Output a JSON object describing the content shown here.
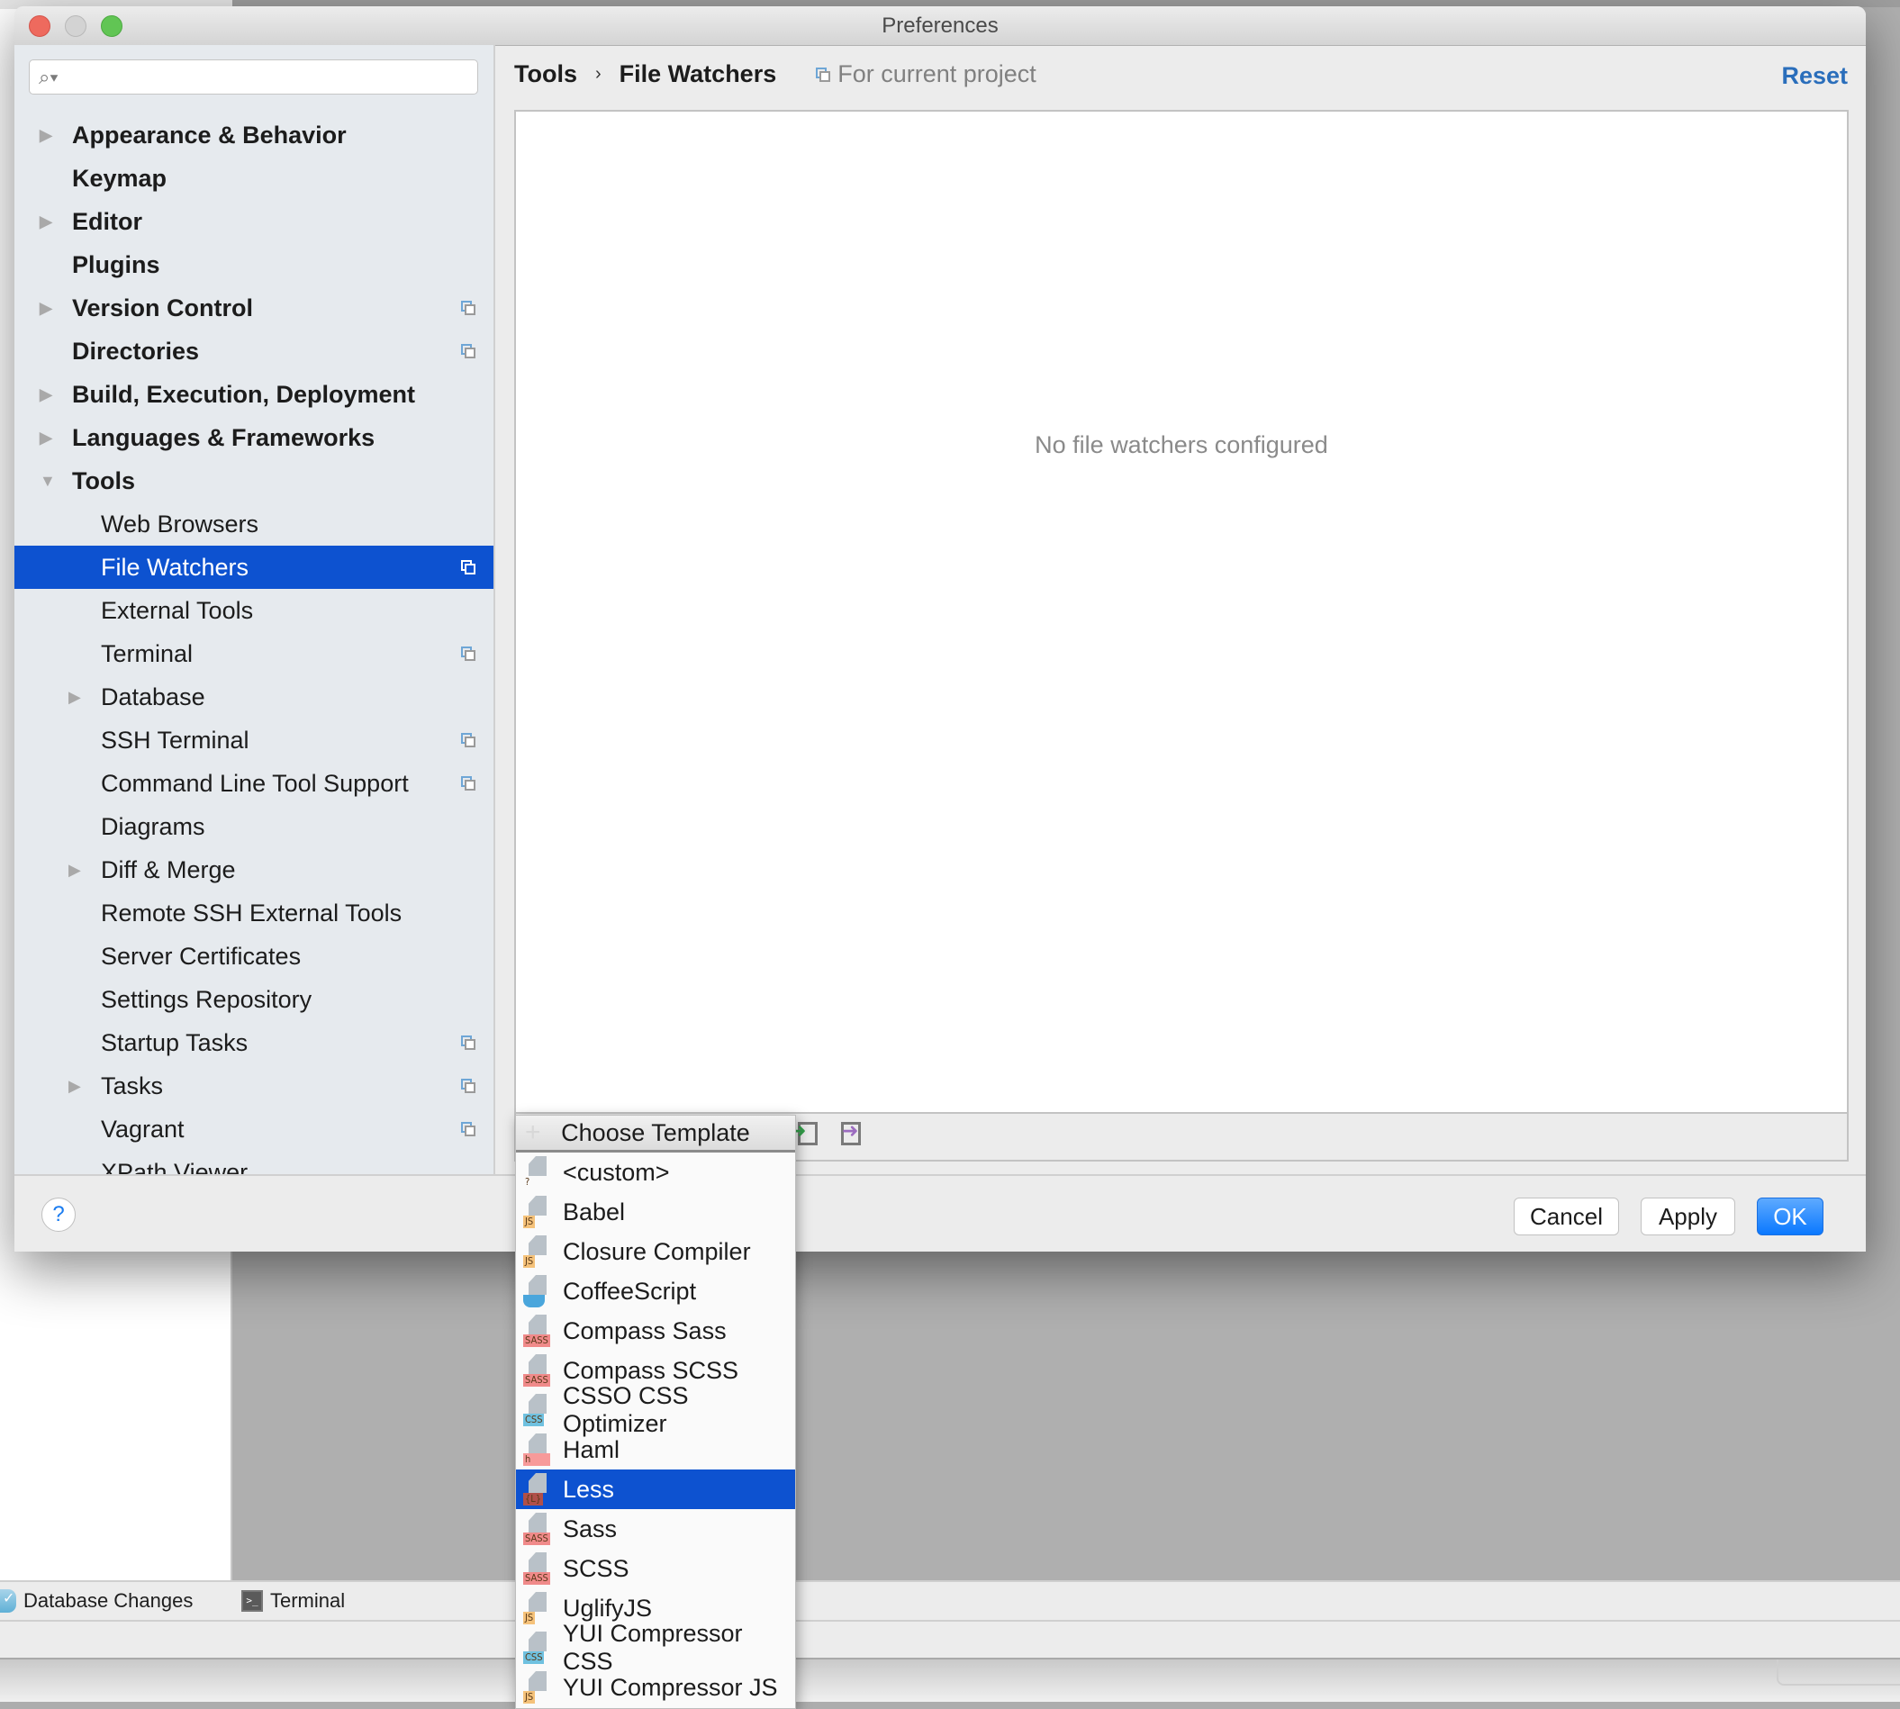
{
  "window": {
    "title": "Preferences"
  },
  "search": {
    "placeholder": "",
    "value": ""
  },
  "sidebar": {
    "items": [
      {
        "label": "Appearance & Behavior",
        "level": 0,
        "bold": true,
        "expandable": true,
        "expanded": false,
        "project_scope": false
      },
      {
        "label": "Keymap",
        "level": 0,
        "bold": true,
        "expandable": false,
        "project_scope": false
      },
      {
        "label": "Editor",
        "level": 0,
        "bold": true,
        "expandable": true,
        "expanded": false,
        "project_scope": false
      },
      {
        "label": "Plugins",
        "level": 0,
        "bold": true,
        "expandable": false,
        "project_scope": false
      },
      {
        "label": "Version Control",
        "level": 0,
        "bold": true,
        "expandable": true,
        "expanded": false,
        "project_scope": true
      },
      {
        "label": "Directories",
        "level": 0,
        "bold": true,
        "expandable": false,
        "project_scope": true
      },
      {
        "label": "Build, Execution, Deployment",
        "level": 0,
        "bold": true,
        "expandable": true,
        "expanded": false,
        "project_scope": false
      },
      {
        "label": "Languages & Frameworks",
        "level": 0,
        "bold": true,
        "expandable": true,
        "expanded": false,
        "project_scope": false
      },
      {
        "label": "Tools",
        "level": 0,
        "bold": true,
        "expandable": true,
        "expanded": true,
        "project_scope": false
      },
      {
        "label": "Web Browsers",
        "level": 1,
        "expandable": false,
        "project_scope": false
      },
      {
        "label": "File Watchers",
        "level": 1,
        "expandable": false,
        "project_scope": true,
        "selected": true
      },
      {
        "label": "External Tools",
        "level": 1,
        "expandable": false,
        "project_scope": false
      },
      {
        "label": "Terminal",
        "level": 1,
        "expandable": false,
        "project_scope": true
      },
      {
        "label": "Database",
        "level": 1,
        "expandable": true,
        "expanded": false,
        "project_scope": false
      },
      {
        "label": "SSH Terminal",
        "level": 1,
        "expandable": false,
        "project_scope": true
      },
      {
        "label": "Command Line Tool Support",
        "level": 1,
        "expandable": false,
        "project_scope": true
      },
      {
        "label": "Diagrams",
        "level": 1,
        "expandable": false,
        "project_scope": false
      },
      {
        "label": "Diff & Merge",
        "level": 1,
        "expandable": true,
        "expanded": false,
        "project_scope": false
      },
      {
        "label": "Remote SSH External Tools",
        "level": 1,
        "expandable": false,
        "project_scope": false
      },
      {
        "label": "Server Certificates",
        "level": 1,
        "expandable": false,
        "project_scope": false
      },
      {
        "label": "Settings Repository",
        "level": 1,
        "expandable": false,
        "project_scope": false
      },
      {
        "label": "Startup Tasks",
        "level": 1,
        "expandable": false,
        "project_scope": true
      },
      {
        "label": "Tasks",
        "level": 1,
        "expandable": true,
        "expanded": false,
        "project_scope": true
      },
      {
        "label": "Vagrant",
        "level": 1,
        "expandable": false,
        "project_scope": true
      },
      {
        "label": "XPath Viewer",
        "level": 1,
        "expandable": false,
        "project_scope": false
      }
    ]
  },
  "breadcrumb": {
    "parent": "Tools",
    "separator": "›",
    "current": "File Watchers",
    "scope": "For current project"
  },
  "reset_label": "Reset",
  "main": {
    "empty_message": "No file watchers configured"
  },
  "footer": {
    "help_label": "?",
    "cancel_label": "Cancel",
    "apply_label": "Apply",
    "ok_label": "OK"
  },
  "popup": {
    "title": "Choose Template",
    "items": [
      {
        "label": "<custom>",
        "badge": "?",
        "badge_type": "q"
      },
      {
        "label": "Babel",
        "badge": "JS",
        "badge_type": "js"
      },
      {
        "label": "Closure Compiler",
        "badge": "JS",
        "badge_type": "js"
      },
      {
        "label": "CoffeeScript",
        "badge": "",
        "badge_type": "coffee"
      },
      {
        "label": "Compass Sass",
        "badge": "SASS",
        "badge_type": "sass"
      },
      {
        "label": "Compass SCSS",
        "badge": "SASS",
        "badge_type": "sass"
      },
      {
        "label": "CSSO CSS Optimizer",
        "badge": "CSS",
        "badge_type": "css"
      },
      {
        "label": "Haml",
        "badge": "h",
        "badge_type": "h"
      },
      {
        "label": "Less",
        "badge": "{L}",
        "badge_type": "less",
        "selected": true
      },
      {
        "label": "Sass",
        "badge": "SASS",
        "badge_type": "sass"
      },
      {
        "label": "SCSS",
        "badge": "SASS",
        "badge_type": "sass"
      },
      {
        "label": "UglifyJS",
        "badge": "JS",
        "badge_type": "js"
      },
      {
        "label": "YUI Compressor CSS",
        "badge": "CSS",
        "badge_type": "css"
      },
      {
        "label": "YUI Compressor JS",
        "badge": "JS",
        "badge_type": "js"
      }
    ]
  },
  "background_ide": {
    "tool_windows": [
      {
        "label": "Database Changes",
        "icon": "database-changes-icon"
      },
      {
        "label": "Terminal",
        "icon": "terminal-icon"
      }
    ]
  },
  "colors": {
    "selection": "#0d52d0",
    "link": "#2a6ebb",
    "ok_button": "#0a78ff"
  }
}
